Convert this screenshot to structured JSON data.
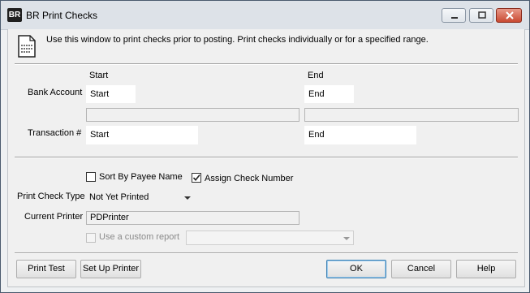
{
  "window": {
    "title": "BR Print Checks",
    "icon_text": "BR",
    "controls": [
      "minimize-icon",
      "maximize-icon",
      "close-icon"
    ]
  },
  "header": {
    "info": "Use this window to print checks prior to posting.  Print checks individually or for a specified range.",
    "icon": "document-icon"
  },
  "range": {
    "start_heading": "Start",
    "end_heading": "End",
    "bank_account": {
      "label": "Bank Account",
      "start": "Start",
      "end": "End"
    },
    "transaction": {
      "label": "Transaction #",
      "start": "Start",
      "end": "End"
    }
  },
  "options": {
    "sort_by_payee": {
      "label": "Sort By Payee Name",
      "checked": false
    },
    "assign_check_number": {
      "label": "Assign Check Number",
      "checked": true
    },
    "print_check_type": {
      "label": "Print Check Type",
      "value": "Not Yet Printed"
    },
    "current_printer": {
      "label": "Current Printer",
      "value": "PDPrinter"
    },
    "custom_report": {
      "label": "Use a custom report",
      "checked": false,
      "enabled": false,
      "value": ""
    }
  },
  "buttons": {
    "print_test": "Print Test",
    "set_up_printer": "Set Up Printer",
    "ok": "OK",
    "cancel": "Cancel",
    "help": "Help"
  },
  "colors": {
    "default_button_border": "#3c7fb1",
    "close_button": "#c94a32"
  }
}
